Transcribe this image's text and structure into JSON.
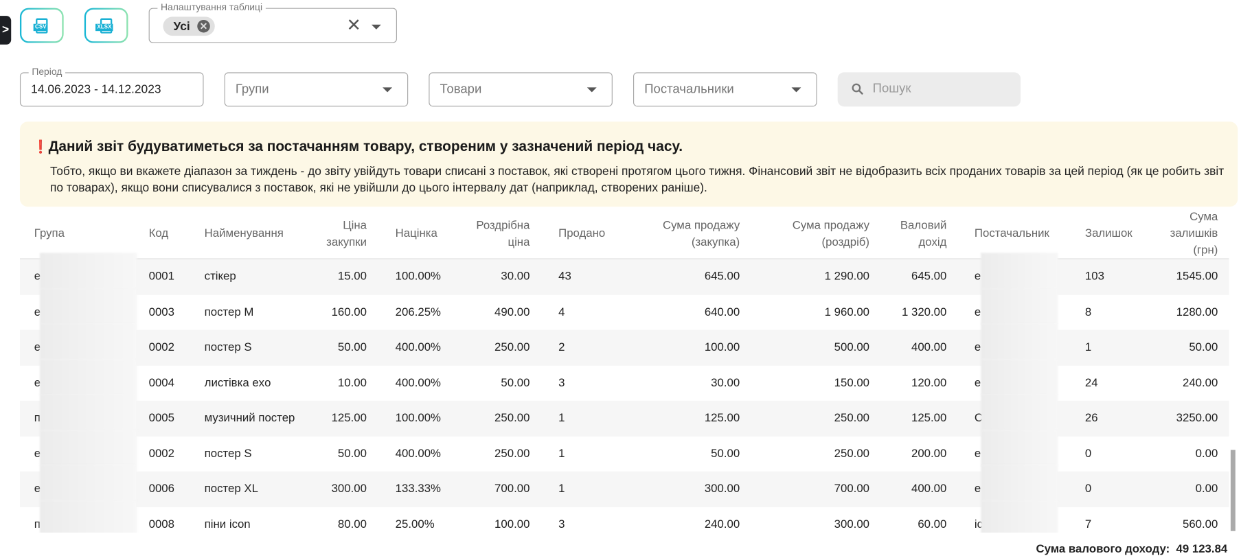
{
  "toolbar": {
    "expand_icon": ">",
    "csv_label": "CSV",
    "xlsx_label": "XLSX",
    "table_settings": {
      "label": "Налаштування таблиці",
      "chip": "Усі"
    }
  },
  "filters": {
    "period_label": "Період",
    "period_value": "14.06.2023 - 14.12.2023",
    "groups_placeholder": "Групи",
    "products_placeholder": "Товари",
    "suppliers_placeholder": "Постачальники",
    "search_placeholder": "Пошук"
  },
  "notice": {
    "icon": "❗",
    "title": "Даний звіт будуватиметься за постачанням товару, створеним у зазначений період часу.",
    "text": "Тобто, якщо ви вкажете діапазон за тиждень - до звіту увійдуть товари списані з поставок, які створені протягом цього тижня. Фінансовий звіт не відобразить всіх проданих товарів за цей період (як це робить звіт по товарах), якщо вони списувалися з поставок, які не увійшли до цього інтервалу дат (наприклад, створених раніше)."
  },
  "table": {
    "headers": [
      "Група",
      "Код",
      "Найменування",
      "Ціна закупки",
      "Націнка",
      "Роздрібна ціна",
      "Продано",
      "Сума продажу (закупка)",
      "Сума продажу (роздріб)",
      "Валовий дохід",
      "Постачальник",
      "Залишок",
      "Сума залишків (грн)"
    ],
    "rows": [
      [
        "е",
        "0001",
        "стікер",
        "15.00",
        "100.00%",
        "30.00",
        "43",
        "645.00",
        "1 290.00",
        "645.00",
        "е",
        "103",
        "1545.00"
      ],
      [
        "е",
        "0003",
        "постер M",
        "160.00",
        "206.25%",
        "490.00",
        "4",
        "640.00",
        "1 960.00",
        "1 320.00",
        "е",
        "8",
        "1280.00"
      ],
      [
        "е",
        "0002",
        "постер S",
        "50.00",
        "400.00%",
        "250.00",
        "2",
        "100.00",
        "500.00",
        "400.00",
        "е",
        "1",
        "50.00"
      ],
      [
        "е",
        "0004",
        "листівка exo",
        "10.00",
        "400.00%",
        "50.00",
        "3",
        "30.00",
        "150.00",
        "120.00",
        "е",
        "24",
        "240.00"
      ],
      [
        "п",
        "0005",
        "музичний постер",
        "125.00",
        "100.00%",
        "250.00",
        "1",
        "125.00",
        "250.00",
        "125.00",
        "C",
        "26",
        "3250.00"
      ],
      [
        "е",
        "0002",
        "постер S",
        "50.00",
        "400.00%",
        "250.00",
        "1",
        "50.00",
        "250.00",
        "200.00",
        "е",
        "0",
        "0.00"
      ],
      [
        "е",
        "0006",
        "постер XL",
        "300.00",
        "133.33%",
        "700.00",
        "1",
        "300.00",
        "700.00",
        "400.00",
        "е",
        "0",
        "0.00"
      ],
      [
        "п",
        "0008",
        "піни icon",
        "80.00",
        "25.00%",
        "100.00",
        "3",
        "240.00",
        "300.00",
        "60.00",
        "ic",
        "7",
        "560.00"
      ]
    ]
  },
  "footer": {
    "label": "Сума валового доходу:",
    "value": "49 123.84"
  }
}
